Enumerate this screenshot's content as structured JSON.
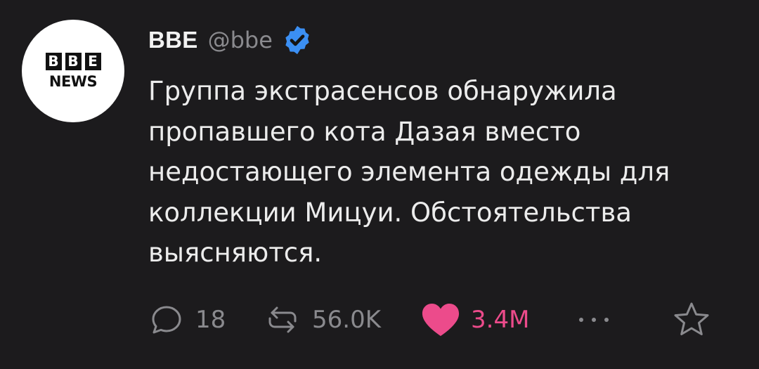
{
  "author": {
    "avatar_logo_letters": [
      "B",
      "B",
      "E"
    ],
    "avatar_logo_sub": "NEWS",
    "name": "BBE",
    "handle": "@bbe",
    "verified_icon": "verified-badge-icon"
  },
  "post": {
    "text": "Группа экстрасенсов обнаружила пропавшего кота Дазая вместо недостающего элемента одежды для коллекции Мицуи. Обстоятельства выясняются."
  },
  "actions": {
    "reply": {
      "icon": "reply-icon",
      "count": "18"
    },
    "repost": {
      "icon": "repost-icon",
      "count": "56.0K"
    },
    "like": {
      "icon": "heart-icon",
      "count": "3.4M",
      "liked": true
    },
    "more": {
      "icon": "more-icon"
    },
    "bookmark": {
      "icon": "star-icon"
    }
  },
  "colors": {
    "background": "#1c1b1d",
    "text": "#ececec",
    "muted": "#8a8a8e",
    "like": "#ec4b8b",
    "verified": "#3b8ff3"
  }
}
